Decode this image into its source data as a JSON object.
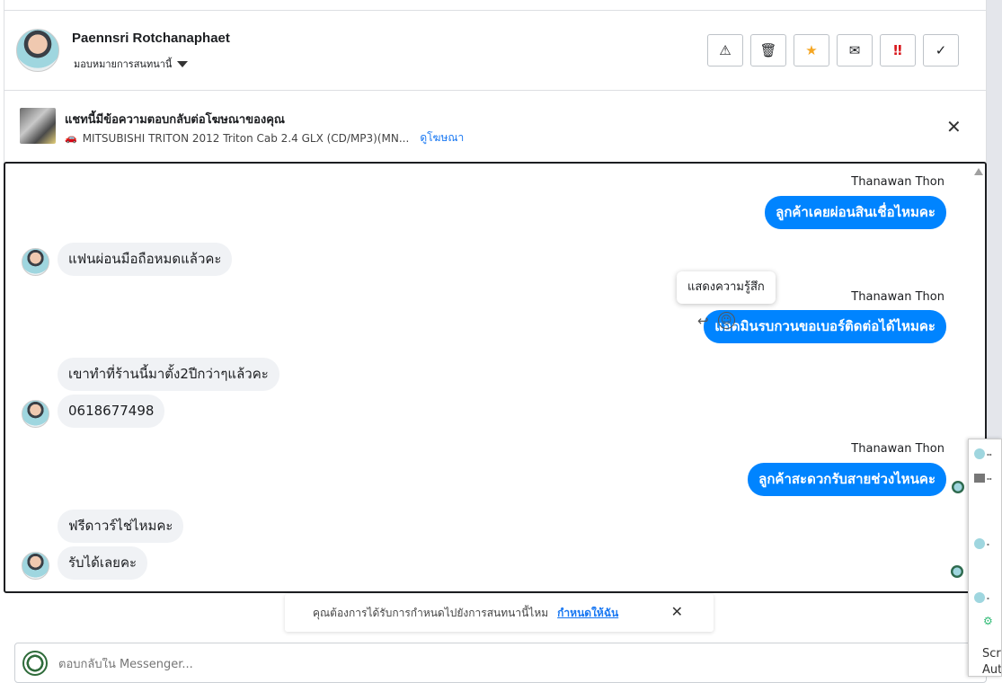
{
  "header": {
    "contact_name": "Paennsri Rotchanaphaet",
    "assign_label": "มอบหมายการสนทนานี้",
    "actions": [
      {
        "name": "spam",
        "icon": "warning-icon",
        "label": "⚠"
      },
      {
        "name": "delete",
        "icon": "trash-icon",
        "label": "🗑"
      },
      {
        "name": "follow-up",
        "icon": "star-icon",
        "label": "★"
      },
      {
        "name": "mark-unread",
        "icon": "envelope-open-icon",
        "label": "✉"
      },
      {
        "name": "priority",
        "icon": "exclamation-icon",
        "label": "‼"
      },
      {
        "name": "done",
        "icon": "check-icon",
        "label": "✓"
      }
    ]
  },
  "ad": {
    "title": "แชทนี้มีข้อความตอบกลับต่อโฆษณาของคุณ",
    "vehicle": "MITSUBISHI TRITON 2012 Triton Cab 2.4 GLX (CD/MP3)(MN...",
    "link": "ดูโฆษณา",
    "close": "✕"
  },
  "messages": [
    {
      "sender": "Thanawan Thon",
      "direction": "out",
      "text": "ลูกค้าเคยผ่อนสินเชื่อไหมคะ"
    },
    {
      "direction": "in",
      "text": "แฟนผ่อนมือถือหมดแล้วคะ"
    },
    {
      "sender": "Thanawan Thon",
      "direction": "out",
      "text": "แอดมินรบกวนขอเบอร์ติดต่อได้ไหมคะ"
    },
    {
      "direction": "in",
      "text": "เขาทำที่ร้านนี้มาตั้ง2ปีกว่าๆแล้วคะ"
    },
    {
      "direction": "in",
      "text": "0618677498"
    },
    {
      "sender": "Thanawan Thon",
      "direction": "out",
      "text": "ลูกค้าสะดวกรับสายช่วงไหนคะ"
    },
    {
      "direction": "in",
      "text": "ฟรีดาวร์ไช่ไหมคะ"
    },
    {
      "direction": "in",
      "text": "รับได้เลยคะ"
    }
  ],
  "tooltip": "แสดงความรู้สึก",
  "message_tools": {
    "reply": "↩",
    "react": "☺"
  },
  "assign_prompt": {
    "text": "คุณต้องการได้รับการกำหนดไปยังการสนทนานี้ไหม",
    "link": "กำหนดให้ฉัน",
    "close": "✕"
  },
  "composer": {
    "placeholder": "ตอบกลับใน Messenger..."
  },
  "side_panel": {
    "text_line1": "Scre",
    "text_line2": "Aut"
  },
  "colors": {
    "outgoing": "#0084ff",
    "incoming": "#f0f2f5",
    "link": "#1877f2"
  }
}
